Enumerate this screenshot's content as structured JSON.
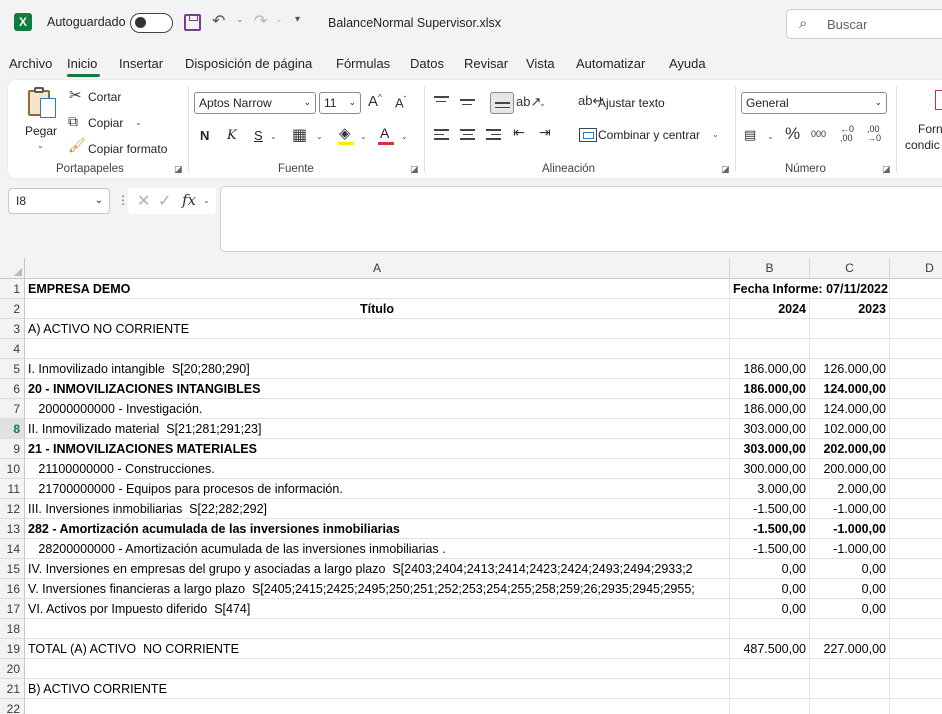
{
  "titlebar": {
    "logo_letter": "X",
    "autosave_label": "Autoguardado",
    "filename": "BalanceNormal Supervisor.xlsx",
    "search_placeholder": "Buscar"
  },
  "menu": [
    "Archivo",
    "Inicio",
    "Insertar",
    "Disposición de página",
    "Fórmulas",
    "Datos",
    "Revisar",
    "Vista",
    "Automatizar",
    "Ayuda"
  ],
  "ribbon": {
    "clipboard": {
      "paste": "Pegar",
      "cut": "Cortar",
      "copy": "Copiar",
      "format_painter": "Copiar formato",
      "group_label": "Portapapeles"
    },
    "font": {
      "font_name": "Aptos Narrow",
      "font_size": "11",
      "bold": "N",
      "italic": "K",
      "underline": "S",
      "font_color_letter": "A",
      "group_label": "Fuente"
    },
    "alignment": {
      "wrap_text": "Ajustar texto",
      "merge_center": "Combinar y centrar",
      "group_label": "Alineación"
    },
    "number": {
      "format": "General",
      "group_label": "Número"
    },
    "styles": {
      "conditional_line1": "Forn",
      "conditional_line2": "condic"
    }
  },
  "formula_bar": {
    "name_box": "I8",
    "formula": ""
  },
  "grid": {
    "columns": [
      "A",
      "B",
      "C",
      "D"
    ],
    "active_row": 8,
    "rows": [
      {
        "n": 1,
        "a": "EMPRESA DEMO",
        "b": "Fecha Informe: 07/11/2022",
        "c": "",
        "bold": true,
        "a_center": false,
        "span_bc": true
      },
      {
        "n": 2,
        "a": "Título",
        "b": "2024",
        "c": "2023",
        "bold": true,
        "a_center": true
      },
      {
        "n": 3,
        "a": "A) ACTIVO NO CORRIENTE",
        "b": "",
        "c": ""
      },
      {
        "n": 4,
        "a": "",
        "b": "",
        "c": ""
      },
      {
        "n": 5,
        "a": "I. Inmovilizado intangible  S[20;280;290]",
        "b": "186.000,00",
        "c": "126.000,00"
      },
      {
        "n": 6,
        "a": "20 - INMOVILIZACIONES INTANGIBLES",
        "b": "186.000,00",
        "c": "124.000,00",
        "bold": true
      },
      {
        "n": 7,
        "a": "   20000000000 - Investigación.",
        "b": "186.000,00",
        "c": "124.000,00"
      },
      {
        "n": 8,
        "a": "II. Inmovilizado material  S[21;281;291;23]",
        "b": "303.000,00",
        "c": "102.000,00"
      },
      {
        "n": 9,
        "a": "21 - INMOVILIZACIONES MATERIALES",
        "b": "303.000,00",
        "c": "202.000,00",
        "bold": true
      },
      {
        "n": 10,
        "a": "   21100000000 - Construcciones.",
        "b": "300.000,00",
        "c": "200.000,00"
      },
      {
        "n": 11,
        "a": "   21700000000 - Equipos para procesos de información.",
        "b": "3.000,00",
        "c": "2.000,00"
      },
      {
        "n": 12,
        "a": "III. Inversiones inmobiliarias  S[22;282;292]",
        "b": "-1.500,00",
        "c": "-1.000,00"
      },
      {
        "n": 13,
        "a": "282 - Amortización acumulada de las inversiones inmobiliarias",
        "b": "-1.500,00",
        "c": "-1.000,00",
        "bold": true
      },
      {
        "n": 14,
        "a": "   28200000000 - Amortización acumulada de las inversiones inmobiliarias .",
        "b": "-1.500,00",
        "c": "-1.000,00"
      },
      {
        "n": 15,
        "a": "IV. Inversiones en empresas del grupo y asociadas a largo plazo  S[2403;2404;2413;2414;2423;2424;2493;2494;2933;2",
        "b": "0,00",
        "c": "0,00"
      },
      {
        "n": 16,
        "a": "V. Inversiones financieras a largo plazo  S[2405;2415;2425;2495;250;251;252;253;254;255;258;259;26;2935;2945;2955;",
        "b": "0,00",
        "c": "0,00"
      },
      {
        "n": 17,
        "a": "VI. Activos por Impuesto diferido  S[474]",
        "b": "0,00",
        "c": "0,00"
      },
      {
        "n": 18,
        "a": "",
        "b": "",
        "c": ""
      },
      {
        "n": 19,
        "a": "TOTAL (A) ACTIVO  NO CORRIENTE",
        "b": "487.500,00",
        "c": "227.000,00"
      },
      {
        "n": 20,
        "a": "",
        "b": "",
        "c": ""
      },
      {
        "n": 21,
        "a": "B) ACTIVO CORRIENTE",
        "b": "",
        "c": ""
      },
      {
        "n": 22,
        "a": "",
        "b": "",
        "c": ""
      }
    ]
  }
}
